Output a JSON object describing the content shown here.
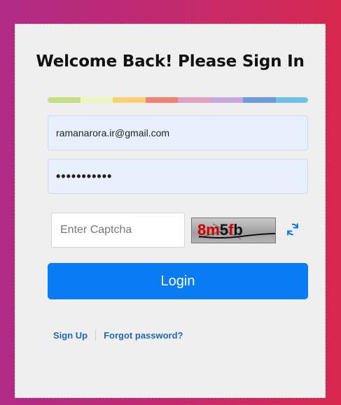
{
  "login": {
    "title": "Welcome Back! Please Sign In",
    "color_bar": [
      "#c5df86",
      "#eef6c0",
      "#fbcf74",
      "#f08172",
      "#e2a2c2",
      "#c7a7e0",
      "#6d9be0",
      "#6ec2e8"
    ],
    "email_value": "ramanarora.ir@gmail.com",
    "password_mask": "•••••••••••",
    "captcha_placeholder": "Enter Captcha",
    "captcha_text": "8m5fb",
    "refresh_icon": "refresh-icon",
    "login_label": "Login",
    "signup_label": "Sign Up",
    "forgot_label": "Forgot password?"
  },
  "colors": {
    "accent": "#0a7cf3",
    "link": "#2168b3",
    "background_start": "#b02a86",
    "background_end": "#d6284e"
  }
}
